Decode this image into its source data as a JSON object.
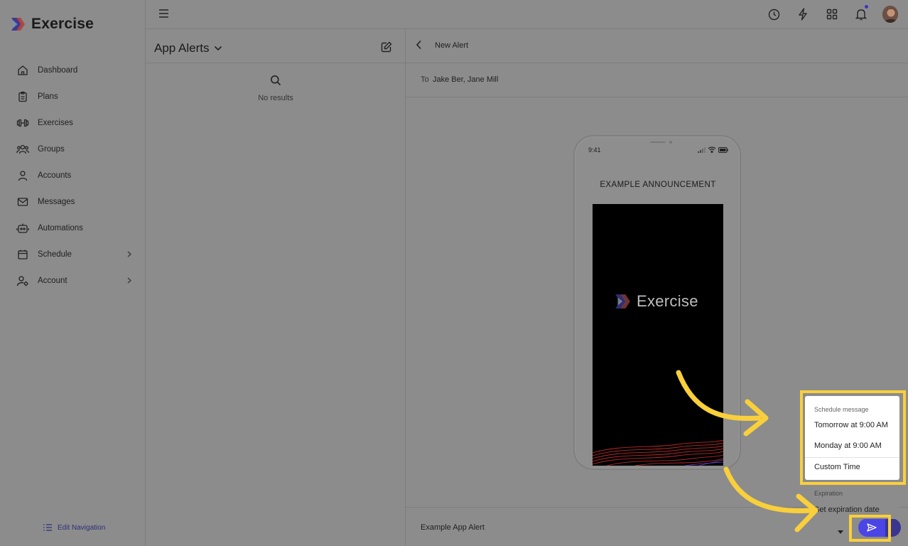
{
  "app": {
    "brand": "Exercise"
  },
  "sidebar": {
    "items": [
      {
        "label": "Dashboard",
        "icon": "home-icon"
      },
      {
        "label": "Plans",
        "icon": "clipboard-icon"
      },
      {
        "label": "Exercises",
        "icon": "dumbbell-icon"
      },
      {
        "label": "Groups",
        "icon": "users-icon"
      },
      {
        "label": "Accounts",
        "icon": "user-icon"
      },
      {
        "label": "Messages",
        "icon": "mail-icon"
      },
      {
        "label": "Automations",
        "icon": "robot-icon"
      },
      {
        "label": "Schedule",
        "icon": "calendar-icon",
        "has_submenu": true
      },
      {
        "label": "Account",
        "icon": "user-gear-icon",
        "has_submenu": true
      }
    ],
    "edit_navigation": "Edit Navigation"
  },
  "topbar": {
    "icons": [
      "history-icon",
      "bolt-icon",
      "grid-icon",
      "bell-icon",
      "avatar"
    ]
  },
  "alerts": {
    "title": "App Alerts",
    "empty_text": "No results"
  },
  "detail": {
    "title": "New Alert",
    "to_label": "To",
    "recipients": "Jake Ber, Jane Mill",
    "preview": {
      "time": "9:41",
      "heading": "EXAMPLE ANNOUNCEMENT",
      "banner_brand": "Exercise"
    },
    "footer_text": "Example App Alert"
  },
  "schedule_menu": {
    "header": "Schedule message",
    "options": [
      "Tomorrow at 9:00 AM",
      "Monday at 9:00 AM",
      "Custom Time"
    ],
    "expiration_header": "Expiration",
    "expiration_option": "Set expiration date"
  },
  "colors": {
    "accent": "#4b45e6",
    "highlight": "#f9cf3b"
  }
}
